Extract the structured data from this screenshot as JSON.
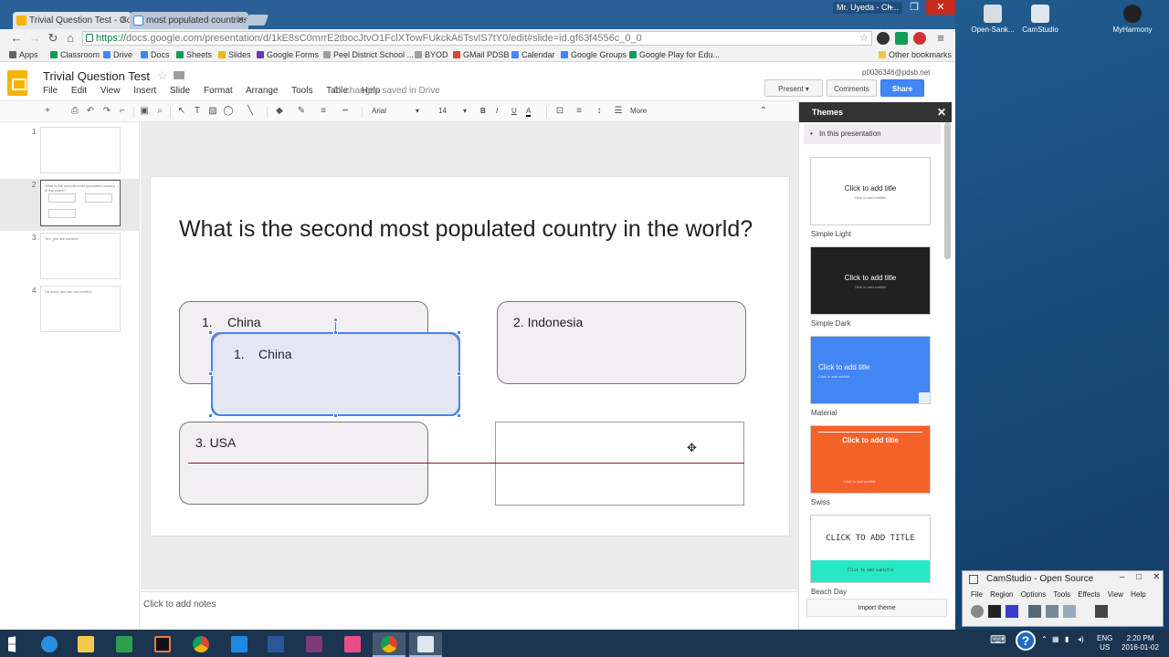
{
  "browser": {
    "tabs": [
      {
        "label": "Trivial Question Test - Go"
      },
      {
        "label": "most populated countries"
      }
    ],
    "window_user": "Mr. Uyeda - Ch...",
    "url_scheme": "https://",
    "url_rest": "docs.google.com/presentation/d/1kE8sC0mrrE2tbocJtvO1FclXTowFUkckA6TsvlS7tY0/edit#slide=id.gf63f4556c_0_0",
    "bookmarks": [
      {
        "label": "Apps",
        "color": "#5f6368"
      },
      {
        "label": "Classroom",
        "color": "#0f9d58"
      },
      {
        "label": "Drive",
        "color": "#4285f4"
      },
      {
        "label": "Docs",
        "color": "#4285f4"
      },
      {
        "label": "Sheets",
        "color": "#0f9d58"
      },
      {
        "label": "Slides",
        "color": "#f4b400"
      },
      {
        "label": "Google Forms",
        "color": "#673ab7"
      },
      {
        "label": "Peel District School ...",
        "color": "#9e9e9e"
      },
      {
        "label": "BYOD",
        "color": "#9e9e9e"
      },
      {
        "label": "GMail PDSB",
        "color": "#db4437"
      },
      {
        "label": "Calendar",
        "color": "#4285f4"
      },
      {
        "label": "Google Groups",
        "color": "#4285f4"
      },
      {
        "label": "Google Play for Edu...",
        "color": "#0f9d58"
      }
    ],
    "other_bookmarks": "Other bookmarks"
  },
  "app": {
    "doc_title": "Trivial Question Test",
    "menu": [
      "File",
      "Edit",
      "View",
      "Insert",
      "Slide",
      "Format",
      "Arrange",
      "Tools",
      "Table",
      "Help"
    ],
    "save_status": "All changes saved in Drive",
    "account": "p0036346@pdsb.net",
    "present_label": "Present",
    "comments_label": "Comments",
    "share_label": "Share",
    "toolbar": {
      "font": "Arial",
      "size": "14",
      "bold": "B",
      "italic": "I",
      "underline": "U",
      "color": "A",
      "more": "More"
    },
    "slide_numbers": [
      "1",
      "2",
      "3",
      "4"
    ],
    "thumb_texts": [
      "",
      "What is the second most populated country in the world?",
      "Yes, you are correct!",
      "I'm sorry, you are not correct!"
    ],
    "slide": {
      "question": "What is the second most populated country in the world?",
      "box1_num": "1.",
      "box1_text": "China",
      "box_sel_num": "1.",
      "box_sel_text": "China",
      "box2_text": "2.  Indonesia",
      "box3_text": "3.  USA"
    },
    "notes_placeholder": "Click to add notes",
    "themes": {
      "header": "Themes",
      "in_presentation": "In this presentation",
      "items": [
        {
          "name": "Simple Light",
          "title": "Click to add title",
          "subtitle": "Click to add subtitle",
          "bg": "#ffffff",
          "fg": "#222222"
        },
        {
          "name": "Simple Dark",
          "title": "Click to add title",
          "subtitle": "Click to add subtitle",
          "bg": "#212121",
          "fg": "#ffffff"
        },
        {
          "name": "Material",
          "title": "Click to add title",
          "subtitle": "Click to add subtitle",
          "bg": "#4285f4",
          "fg": "#ffffff"
        },
        {
          "name": "Swiss",
          "title": "Click to add title",
          "subtitle": "Click to add subtitle",
          "bg": "#f4622a",
          "fg": "#ffffff"
        },
        {
          "name": "Beach Day",
          "title": "CLICK TO ADD TITLE",
          "subtitle": "Click to add subtitle",
          "bg": "#ffffff",
          "fg": "#222222"
        }
      ],
      "import": "Import theme"
    }
  },
  "desktop": {
    "icons": [
      "Open-Sank...",
      "CamStudio",
      "MyHarmony"
    ]
  },
  "camstudio": {
    "title": "CamStudio - Open Source",
    "menu": "File Region Options Tools Effects View Help"
  },
  "taskbar": {
    "lang": "ENG",
    "region": "US",
    "time": "2:20 PM",
    "date": "2016-01-02"
  }
}
